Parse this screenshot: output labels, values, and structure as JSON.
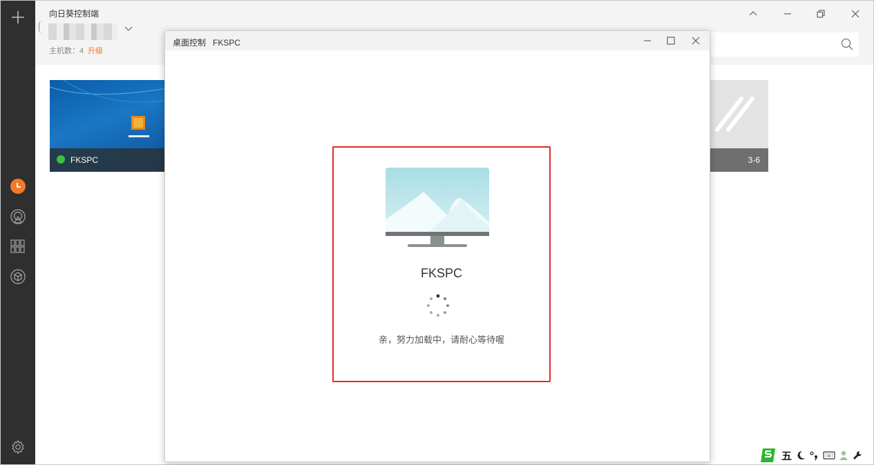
{
  "app": {
    "title": "向日葵控制端",
    "host_count": "主机数：4",
    "upgrade_link": "升级"
  },
  "window_controls": [
    "collapse",
    "minimize",
    "restore",
    "close"
  ],
  "cards": [
    {
      "name": "FKSPC",
      "status_color": "#3cc23c"
    },
    {
      "label": "3-6"
    }
  ],
  "dialog": {
    "title_prefix": "桌面控制",
    "title_host": "FKSPC",
    "host_name": "FKSPC",
    "loading_text": "亲，努力加载中，请耐心等待喔"
  },
  "sidebar": {
    "icons": [
      "add-icon",
      "history-icon",
      "remote-icon",
      "apps-icon",
      "box-icon",
      "settings-icon"
    ],
    "accent": "#f07a2a"
  },
  "tray": {
    "ime_label": "五",
    "icons": [
      "sogou-ime-icon",
      "moon-icon",
      "punctuation-icon",
      "keyboard-icon",
      "user-icon",
      "wrench-icon"
    ]
  }
}
